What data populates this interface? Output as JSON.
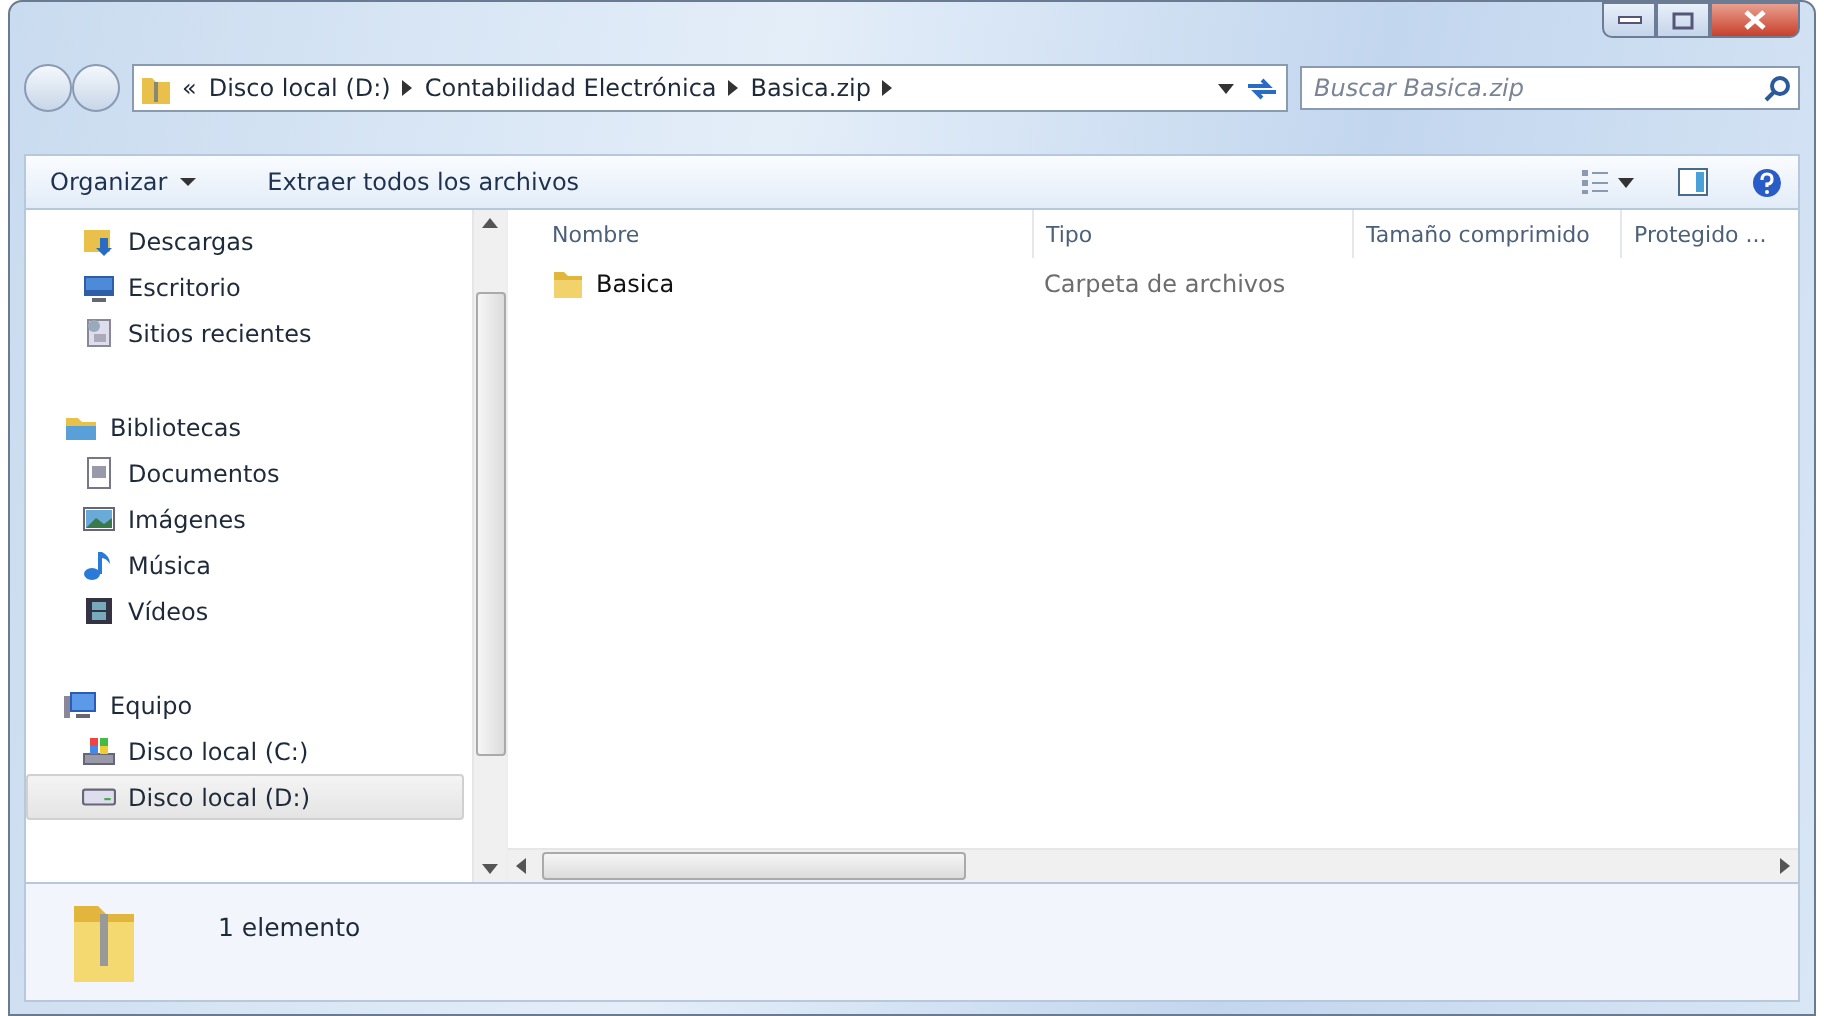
{
  "address_bar": {
    "overflow": "«",
    "crumbs": [
      "Disco local (D:)",
      "Contabilidad Electrónica",
      "Basica.zip"
    ]
  },
  "search": {
    "placeholder": "Buscar Basica.zip"
  },
  "toolbar": {
    "buttons": [
      {
        "label": "Organizar",
        "dropdown": true
      },
      {
        "label": "Extraer todos los archivos",
        "dropdown": false
      }
    ]
  },
  "sidebar": {
    "sections": [
      {
        "items": [
          {
            "label": "Descargas",
            "kind": "downloads",
            "selected": false
          },
          {
            "label": "Escritorio",
            "kind": "desktop",
            "selected": false
          },
          {
            "label": "Sitios recientes",
            "kind": "recent",
            "selected": false
          }
        ]
      },
      {
        "label": "Bibliotecas",
        "kind": "library",
        "children": [
          {
            "label": "Documentos",
            "kind": "documents",
            "selected": false
          },
          {
            "label": "Imágenes",
            "kind": "pictures",
            "selected": false
          },
          {
            "label": "Música",
            "kind": "music",
            "selected": false
          },
          {
            "label": "Vídeos",
            "kind": "videos",
            "selected": false
          }
        ]
      },
      {
        "label": "Equipo",
        "kind": "computer",
        "children": [
          {
            "label": "Disco local (C:)",
            "kind": "system-drive",
            "selected": false
          },
          {
            "label": "Disco local (D:)",
            "kind": "drive",
            "selected": true
          }
        ]
      }
    ]
  },
  "table": {
    "columns": [
      "Nombre",
      "Tipo",
      "Tamaño comprimido",
      "Protegido ..."
    ],
    "rows": [
      {
        "name": "Basica",
        "type": "Carpeta de archivos"
      }
    ]
  },
  "status_bar": {
    "text": "1 elemento"
  }
}
